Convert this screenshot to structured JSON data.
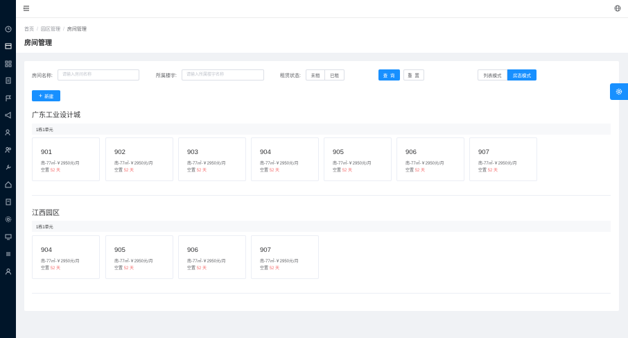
{
  "sidebar": {
    "icons": [
      "clock-icon",
      "calendar-icon",
      "grid-icon",
      "document-icon",
      "flag-icon",
      "megaphone-icon",
      "users-icon",
      "user-group-icon",
      "wrench-icon",
      "home-icon",
      "document-icon",
      "settings-icon",
      "monitor-icon",
      "list-icon",
      "user-icon"
    ]
  },
  "breadcrumb": {
    "home": "首页",
    "parent": "园区管理",
    "current": "房间管理",
    "separator": "/"
  },
  "page_title": "房间管理",
  "filters": {
    "room_name_label": "房间名称:",
    "room_name_placeholder": "请输入房间名称",
    "building_label": "所属楼宇:",
    "building_placeholder": "请输入所属楼宇名称",
    "rent_status_label": "租赁状态:",
    "rent_status_options": [
      "未租",
      "已租"
    ],
    "search_label": "查 询",
    "reset_label": "重 置",
    "view_list_label": "列表模式",
    "view_status_label": "房态模式"
  },
  "add_button": {
    "icon": "+",
    "label": "新建"
  },
  "parks": [
    {
      "name": "广东工业设计城",
      "unit": "1栋1单元",
      "rooms": [
        {
          "number": "901",
          "desc": "南-77㎡-￥2950元/月",
          "status_prefix": "空置",
          "days": "52 天"
        },
        {
          "number": "902",
          "desc": "南-77㎡-￥2950元/月",
          "status_prefix": "空置",
          "days": "52 天"
        },
        {
          "number": "903",
          "desc": "南-77㎡-￥2950元/月",
          "status_prefix": "空置",
          "days": "52 天"
        },
        {
          "number": "904",
          "desc": "南-77㎡-￥2950元/月",
          "status_prefix": "空置",
          "days": "52 天"
        },
        {
          "number": "905",
          "desc": "南-77㎡-￥2950元/月",
          "status_prefix": "空置",
          "days": "52 天"
        },
        {
          "number": "906",
          "desc": "南-77㎡-￥2950元/月",
          "status_prefix": "空置",
          "days": "52 天"
        },
        {
          "number": "907",
          "desc": "南-77㎡-￥2950元/月",
          "status_prefix": "空置",
          "days": "52 天"
        }
      ]
    },
    {
      "name": "江西园区",
      "unit": "1栋1单元",
      "rooms": [
        {
          "number": "904",
          "desc": "南-77㎡-￥2950元/月",
          "status_prefix": "空置",
          "days": "52 天"
        },
        {
          "number": "905",
          "desc": "南-77㎡-￥2950元/月",
          "status_prefix": "空置",
          "days": "52 天"
        },
        {
          "number": "906",
          "desc": "南-77㎡-￥2950元/月",
          "status_prefix": "空置",
          "days": "52 天"
        },
        {
          "number": "907",
          "desc": "南-77㎡-￥2950元/月",
          "status_prefix": "空置",
          "days": "52 天"
        }
      ]
    }
  ],
  "colors": {
    "primary": "#1890ff",
    "sidebar": "#001529",
    "vacant_days": "#f56c6c"
  }
}
